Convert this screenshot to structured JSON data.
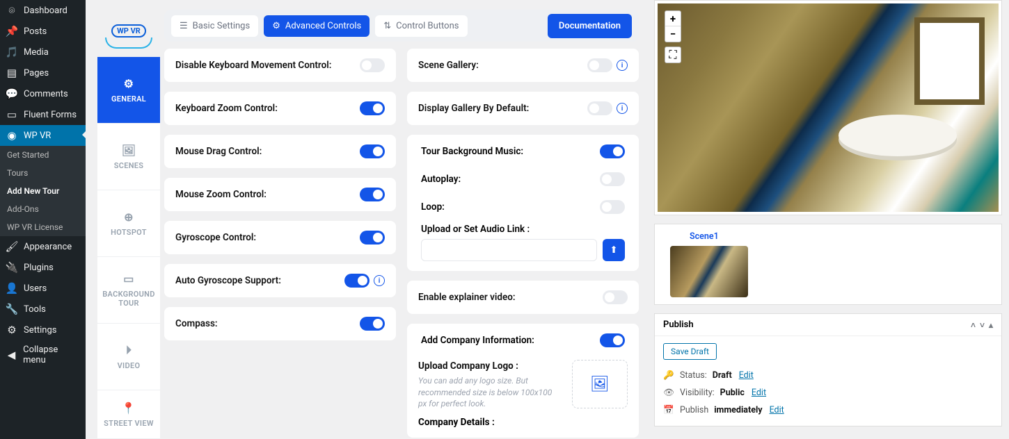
{
  "wp_menu": {
    "dashboard": "Dashboard",
    "posts": "Posts",
    "media": "Media",
    "pages": "Pages",
    "comments": "Comments",
    "fluent_forms": "Fluent Forms",
    "wpvr": "WP VR",
    "appearance": "Appearance",
    "plugins": "Plugins",
    "users": "Users",
    "tools": "Tools",
    "settings": "Settings",
    "collapse": "Collapse menu"
  },
  "wp_submenu": {
    "get_started": "Get Started",
    "tours": "Tours",
    "add_new": "Add New Tour",
    "addons": "Add-Ons",
    "license": "WP VR License"
  },
  "logo": {
    "text": "WP VR"
  },
  "side_tabs": {
    "general": "GENERAL",
    "scenes": "SCENES",
    "hotspot": "HOTSPOT",
    "background": "BACKGROUND TOUR",
    "video": "VIDEO",
    "street": "STREET VIEW"
  },
  "tabs": {
    "basic": "Basic Settings",
    "advanced": "Advanced Controls",
    "control": "Control Buttons",
    "doc": "Documentation"
  },
  "left_cards": {
    "disable_kb": "Disable Keyboard Movement Control:",
    "kb_zoom": "Keyboard Zoom Control:",
    "mouse_drag": "Mouse Drag Control:",
    "mouse_zoom": "Mouse Zoom Control:",
    "gyro": "Gyroscope Control:",
    "auto_gyro": "Auto Gyroscope Support:",
    "compass": "Compass:"
  },
  "right_cards": {
    "scene_gallery": "Scene Gallery:",
    "display_gallery": "Display Gallery By Default:",
    "bgm": "Tour Background Music:",
    "autoplay": "Autoplay:",
    "loop": "Loop:",
    "upload_audio": "Upload or Set Audio Link :",
    "explainer": "Enable explainer video:",
    "company": "Add Company Information:",
    "logo_title": "Upload Company Logo :",
    "logo_desc": "You can add any logo size. But recommended size is below 100x100 px for perfect look.",
    "company_details": "Company Details :"
  },
  "scene": {
    "name": "Scene1"
  },
  "publish": {
    "title": "Publish",
    "save_draft": "Save Draft",
    "status_label": "Status:",
    "status_val": "Draft",
    "edit": "Edit",
    "vis_label": "Visibility:",
    "vis_val": "Public",
    "pub_label": "Publish",
    "pub_val": "immediately"
  },
  "pv": {
    "plus": "+",
    "minus": "−"
  }
}
